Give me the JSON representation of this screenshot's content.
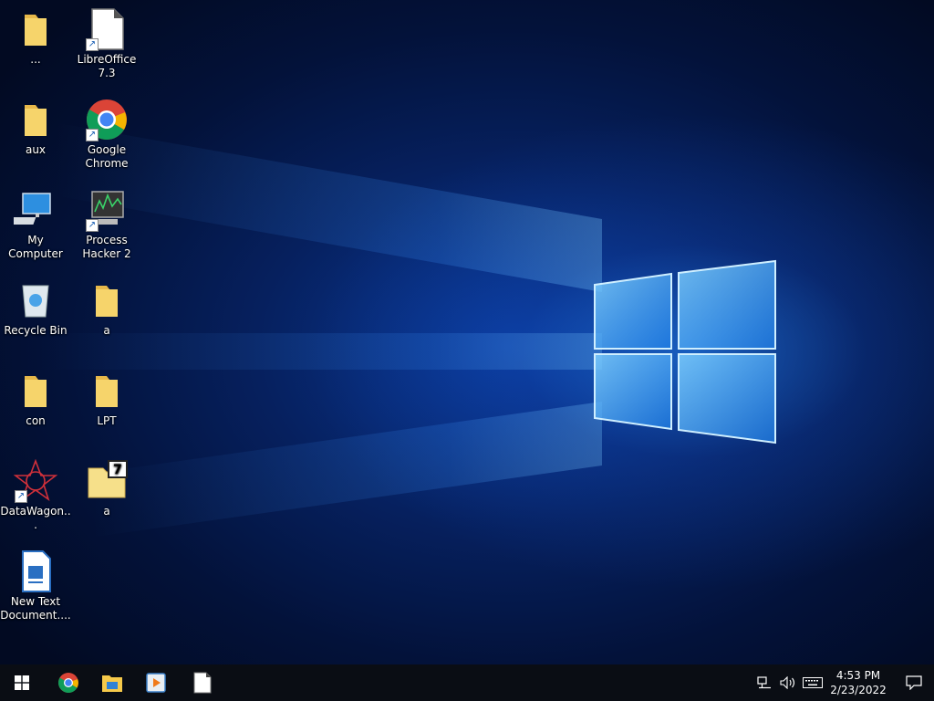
{
  "desktop": {
    "icons": [
      {
        "label": "..."
      },
      {
        "label": "LibreOffice 7.3"
      },
      {
        "label": "aux"
      },
      {
        "label": "Google Chrome"
      },
      {
        "label": "My Computer"
      },
      {
        "label": "Process Hacker 2"
      },
      {
        "label": "Recycle Bin"
      },
      {
        "label": "a"
      },
      {
        "label": "con"
      },
      {
        "label": "LPT"
      },
      {
        "label": "DataWagon..."
      },
      {
        "label": "a"
      },
      {
        "label": "New Text Document...."
      }
    ]
  },
  "taskbar": {
    "start_icon": "windows-logo-icon",
    "pinned": [
      "chrome-icon",
      "file-explorer-icon",
      "media-player-icon",
      "blank-document-icon"
    ],
    "tray": [
      "network-icon",
      "volume-icon",
      "keyboard-icon"
    ],
    "time": "4:53 PM",
    "date": "2/23/2022",
    "notification_icon": "action-center-icon"
  },
  "colors": {
    "taskbar_bg": "#0a0d14",
    "folder_yellow": "#f6d46b",
    "accent_blue": "#1e73e8"
  }
}
